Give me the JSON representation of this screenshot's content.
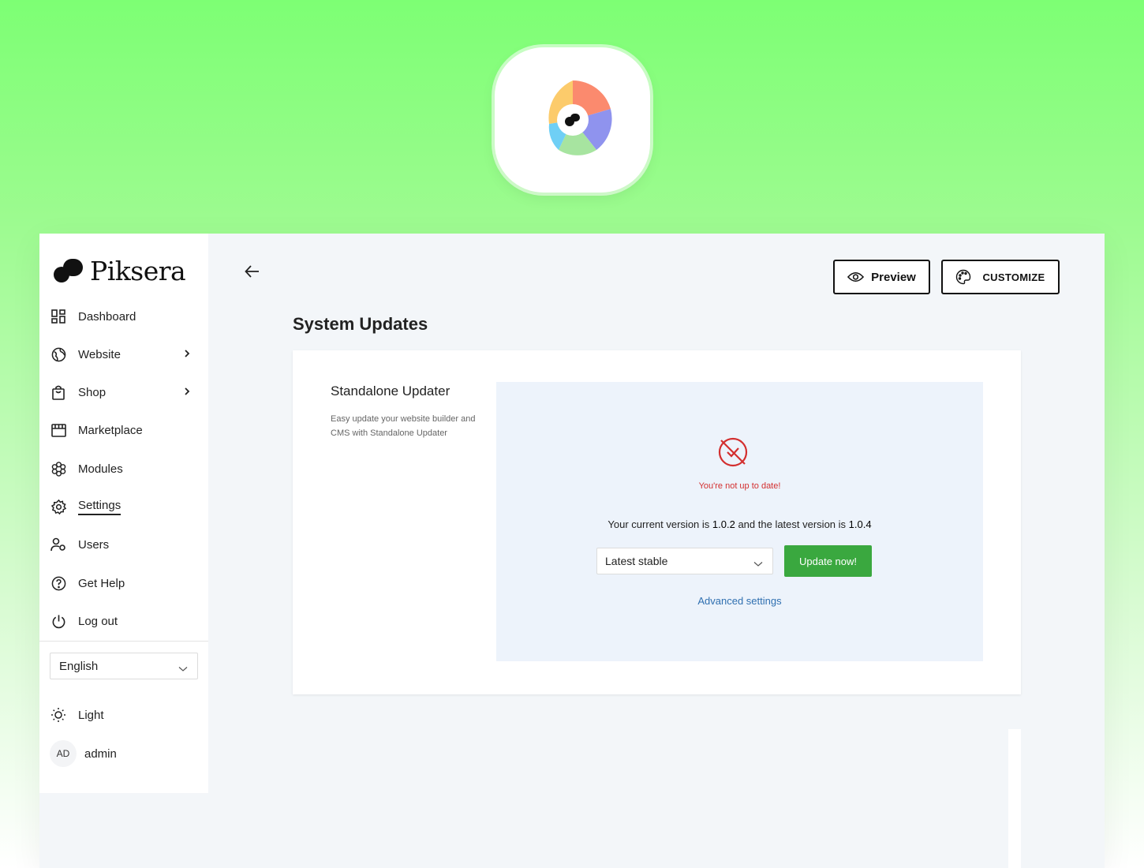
{
  "brand": {
    "name": "Piksera"
  },
  "sidebar": {
    "items": [
      {
        "label": "Dashboard",
        "icon": "dashboard-icon"
      },
      {
        "label": "Website",
        "icon": "globe-icon"
      },
      {
        "label": "Shop",
        "icon": "shopping-bag-icon"
      },
      {
        "label": "Marketplace",
        "icon": "storefront-icon"
      },
      {
        "label": "Modules",
        "icon": "modules-icon"
      },
      {
        "label": "Settings",
        "icon": "gear-icon"
      },
      {
        "label": "Users",
        "icon": "users-icon"
      },
      {
        "label": "Get Help",
        "icon": "help-icon"
      },
      {
        "label": "Log out",
        "icon": "power-icon"
      }
    ],
    "language": "English",
    "theme": "Light",
    "user": {
      "initials": "AD",
      "name": "admin"
    }
  },
  "toolbar": {
    "preview_label": "Preview",
    "customize_label": "CUSTOMIZE"
  },
  "page": {
    "title": "System Updates"
  },
  "updater": {
    "title": "Standalone Updater",
    "description": "Easy update your website builder and CMS with Standalone Updater",
    "status": "You're not up to date!",
    "version_prefix": "Your current version is",
    "current_version": "1.0.2",
    "version_middle": "and the latest version is",
    "latest_version": "1.0.4",
    "channel": "Latest stable",
    "update_label": "Update now!",
    "advanced_label": "Advanced settings"
  },
  "colors": {
    "accent_green": "#3aa83f",
    "error_red": "#d32f2f",
    "link_blue": "#2f6fb0"
  }
}
